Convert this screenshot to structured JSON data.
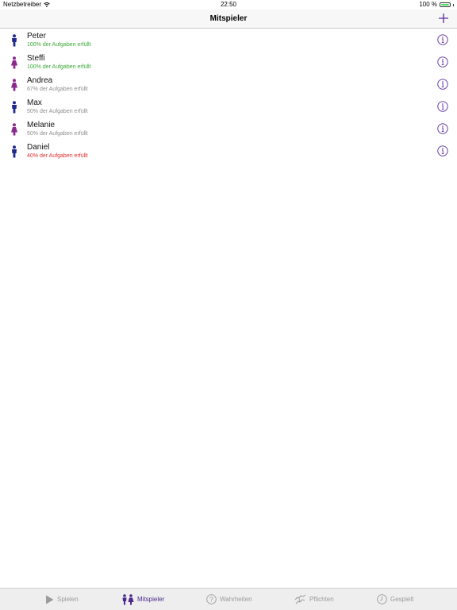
{
  "status_bar": {
    "carrier": "Netzbetreiber",
    "time": "22:50",
    "battery": "100 %"
  },
  "nav": {
    "title": "Mitspieler",
    "add_icon": "plus-icon"
  },
  "colors": {
    "accent": "#5b2c9e",
    "male": "#1f2a8c",
    "female": "#8a2a8e",
    "status_green": "#3aaa35",
    "status_gray": "#8e8e93",
    "status_red": "#e0302f"
  },
  "players": [
    {
      "name": "Peter",
      "status": "100% der Aufgaben erfüllt",
      "status_color": "#3aaa35",
      "gender": "male"
    },
    {
      "name": "Steffi",
      "status": "100% der Aufgaben erfüllt",
      "status_color": "#3aaa35",
      "gender": "female"
    },
    {
      "name": "Andrea",
      "status": "67% der Aufgaben erfüllt",
      "status_color": "#8e8e93",
      "gender": "female"
    },
    {
      "name": "Max",
      "status": "50% der Aufgaben erfüllt",
      "status_color": "#8e8e93",
      "gender": "male"
    },
    {
      "name": "Melanie",
      "status": "50% der Aufgaben erfüllt",
      "status_color": "#8e8e93",
      "gender": "female"
    },
    {
      "name": "Daniel",
      "status": "40% der Aufgaben erfüllt",
      "status_color": "#e0302f",
      "gender": "male"
    }
  ],
  "tabs": [
    {
      "label": "Spielen",
      "icon": "play-icon",
      "active": false
    },
    {
      "label": "Mitspieler",
      "icon": "players-icon",
      "active": true
    },
    {
      "label": "Wahrheiten",
      "icon": "question-icon",
      "active": false
    },
    {
      "label": "Pflichten",
      "icon": "dare-icon",
      "active": false
    },
    {
      "label": "Gespielt",
      "icon": "history-icon",
      "active": false
    }
  ]
}
